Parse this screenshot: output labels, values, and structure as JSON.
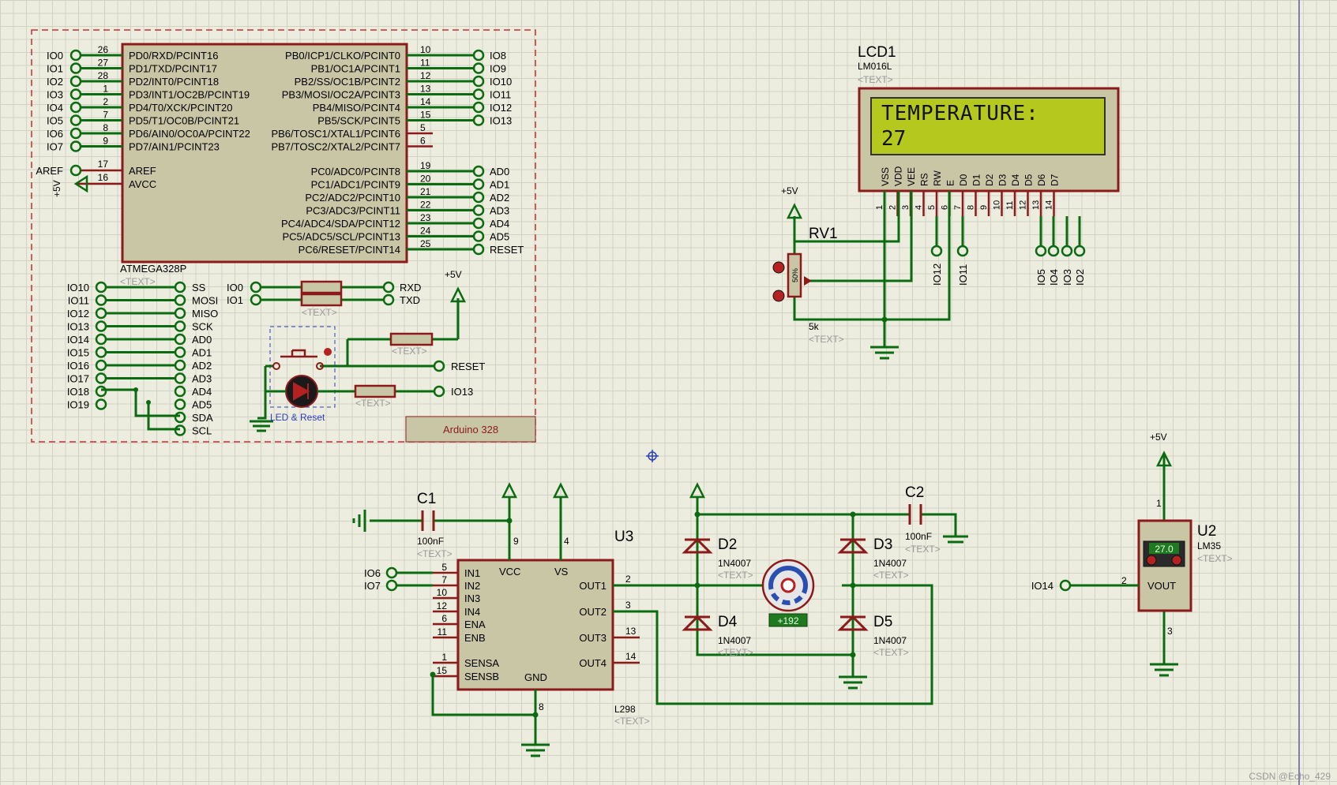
{
  "arduino": {
    "chip_name": "ATMEGA328P",
    "text_placeholder": "<TEXT>",
    "left_pins": [
      {
        "net": "IO0",
        "num": "26",
        "name": "PD0/RXD/PCINT16"
      },
      {
        "net": "IO1",
        "num": "27",
        "name": "PD1/TXD/PCINT17"
      },
      {
        "net": "IO2",
        "num": "28",
        "name": "PD2/INT0/PCINT18"
      },
      {
        "net": "IO3",
        "num": "1",
        "name": "PD3/INT1/OC2B/PCINT19"
      },
      {
        "net": "IO4",
        "num": "2",
        "name": "PD4/T0/XCK/PCINT20"
      },
      {
        "net": "IO5",
        "num": "7",
        "name": "PD5/T1/OC0B/PCINT21"
      },
      {
        "net": "IO6",
        "num": "8",
        "name": "PD6/AIN0/OC0A/PCINT22"
      },
      {
        "net": "IO7",
        "num": "9",
        "name": "PD7/AIN1/PCINT23"
      }
    ],
    "aref": {
      "net": "AREF",
      "num": "17",
      "name": "AREF"
    },
    "avcc": {
      "net": "+5V",
      "num": "16",
      "name": "AVCC"
    },
    "right_pins_b": [
      {
        "net": "IO8",
        "num": "10",
        "name": "PB0/ICP1/CLKO/PCINT0"
      },
      {
        "net": "IO9",
        "num": "11",
        "name": "PB1/OC1A/PCINT1"
      },
      {
        "net": "IO10",
        "num": "12",
        "name": "PB2/SS/OC1B/PCINT2"
      },
      {
        "net": "IO11",
        "num": "13",
        "name": "PB3/MOSI/OC2A/PCINT3"
      },
      {
        "net": "IO12",
        "num": "14",
        "name": "PB4/MISO/PCINT4"
      },
      {
        "net": "IO13",
        "num": "15",
        "name": "PB5/SCK/PCINT5"
      },
      {
        "net": "",
        "num": "5",
        "name": "PB6/TOSC1/XTAL1/PCINT6"
      },
      {
        "net": "",
        "num": "6",
        "name": "PB7/TOSC2/XTAL2/PCINT7"
      }
    ],
    "right_pins_c": [
      {
        "net": "AD0",
        "num": "19",
        "name": "PC0/ADC0/PCINT8"
      },
      {
        "net": "AD1",
        "num": "20",
        "name": "PC1/ADC1/PCINT9"
      },
      {
        "net": "AD2",
        "num": "21",
        "name": "PC2/ADC2/PCINT10"
      },
      {
        "net": "AD3",
        "num": "22",
        "name": "PC3/ADC3/PCINT11"
      },
      {
        "net": "AD4",
        "num": "23",
        "name": "PC4/ADC4/SDA/PCINT12"
      },
      {
        "net": "AD5",
        "num": "24",
        "name": "PC5/ADC5/SCL/PCINT13"
      },
      {
        "net": "RESET",
        "num": "25",
        "name": "PC6/RESET/PCINT14"
      }
    ],
    "alias_left": [
      "IO10",
      "IO11",
      "IO12",
      "IO13",
      "IO14",
      "IO15",
      "IO16",
      "IO17",
      "IO18",
      "IO19"
    ],
    "alias_right": [
      "SS",
      "MOSI",
      "MISO",
      "SCK",
      "AD0",
      "AD1",
      "AD2",
      "AD3",
      "AD4",
      "AD5",
      "SDA",
      "SCL"
    ],
    "uart": {
      "in1": "IO0",
      "in2": "IO1",
      "out1": "RXD",
      "out2": "TXD"
    },
    "reset_net": "RESET",
    "io13_net": "IO13",
    "vcc_label": "+5V",
    "led_reset_label": "LED & Reset",
    "block_label": "Arduino 328"
  },
  "lcd": {
    "ref": "LCD1",
    "part": "LM016L",
    "text_placeholder": "<TEXT>",
    "line1": "TEMPERATURE:",
    "line2": "27",
    "pins": [
      {
        "name": "VSS",
        "num": "1"
      },
      {
        "name": "VDD",
        "num": "2"
      },
      {
        "name": "VEE",
        "num": "3"
      },
      {
        "name": "RS",
        "num": "4"
      },
      {
        "name": "RW",
        "num": "5"
      },
      {
        "name": "E",
        "num": "6"
      },
      {
        "name": "D0",
        "num": "7"
      },
      {
        "name": "D1",
        "num": "8"
      },
      {
        "name": "D2",
        "num": "9"
      },
      {
        "name": "D3",
        "num": "10"
      },
      {
        "name": "D4",
        "num": "11"
      },
      {
        "name": "D5",
        "num": "12"
      },
      {
        "name": "D6",
        "num": "13"
      },
      {
        "name": "D7",
        "num": "14"
      }
    ],
    "nets": [
      "IO12",
      "IO11",
      "IO5",
      "IO4",
      "IO3",
      "IO2"
    ]
  },
  "pot": {
    "ref": "RV1",
    "value": "5k",
    "text_placeholder": "<TEXT>",
    "setting": "50%",
    "vcc": "+5V"
  },
  "c1": {
    "ref": "C1",
    "value": "100nF",
    "text_placeholder": "<TEXT>"
  },
  "c2": {
    "ref": "C2",
    "value": "100nF",
    "text_placeholder": "<TEXT>"
  },
  "l298": {
    "ref": "U3",
    "part": "L298",
    "text_placeholder": "<TEXT>",
    "left_pins": [
      {
        "name": "IN1",
        "num": "5",
        "net": "IO6"
      },
      {
        "name": "IN2",
        "num": "7",
        "net": "IO7"
      },
      {
        "name": "IN3",
        "num": "10",
        "net": ""
      },
      {
        "name": "IN4",
        "num": "12",
        "net": ""
      },
      {
        "name": "ENA",
        "num": "6",
        "net": ""
      },
      {
        "name": "ENB",
        "num": "11",
        "net": ""
      },
      {
        "name": "SENSA",
        "num": "1",
        "net": ""
      },
      {
        "name": "SENSB",
        "num": "15",
        "net": ""
      }
    ],
    "right_pins": [
      {
        "name": "OUT1",
        "num": "2"
      },
      {
        "name": "OUT2",
        "num": "3"
      },
      {
        "name": "OUT3",
        "num": "13"
      },
      {
        "name": "OUT4",
        "num": "14"
      }
    ],
    "vcc": {
      "name": "VCC",
      "num": "9"
    },
    "vs": {
      "name": "VS",
      "num": "4"
    },
    "gnd": {
      "name": "GND",
      "num": "8"
    }
  },
  "diodes": [
    {
      "ref": "D2",
      "part": "1N4007",
      "text_placeholder": "<TEXT>"
    },
    {
      "ref": "D3",
      "part": "1N4007",
      "text_placeholder": "<TEXT>"
    },
    {
      "ref": "D4",
      "part": "1N4007",
      "text_placeholder": "<TEXT>"
    },
    {
      "ref": "D5",
      "part": "1N4007",
      "text_placeholder": "<TEXT>"
    }
  ],
  "motor": {
    "readout": "+192"
  },
  "lm35": {
    "ref": "U2",
    "part": "LM35",
    "text_placeholder": "<TEXT>",
    "readout": "27.0",
    "pin_vout": "VOUT",
    "vout_num": "2",
    "vcc_num": "1",
    "gnd_num": "3",
    "net": "IO14",
    "vcc": "+5V"
  },
  "watermark": "CSDN @Echo_429",
  "colors": {
    "wire": "#0b6b10",
    "body": "#8b1a1a",
    "lcd_bg": "#b5c81e",
    "grid": "#d2d2c4"
  }
}
